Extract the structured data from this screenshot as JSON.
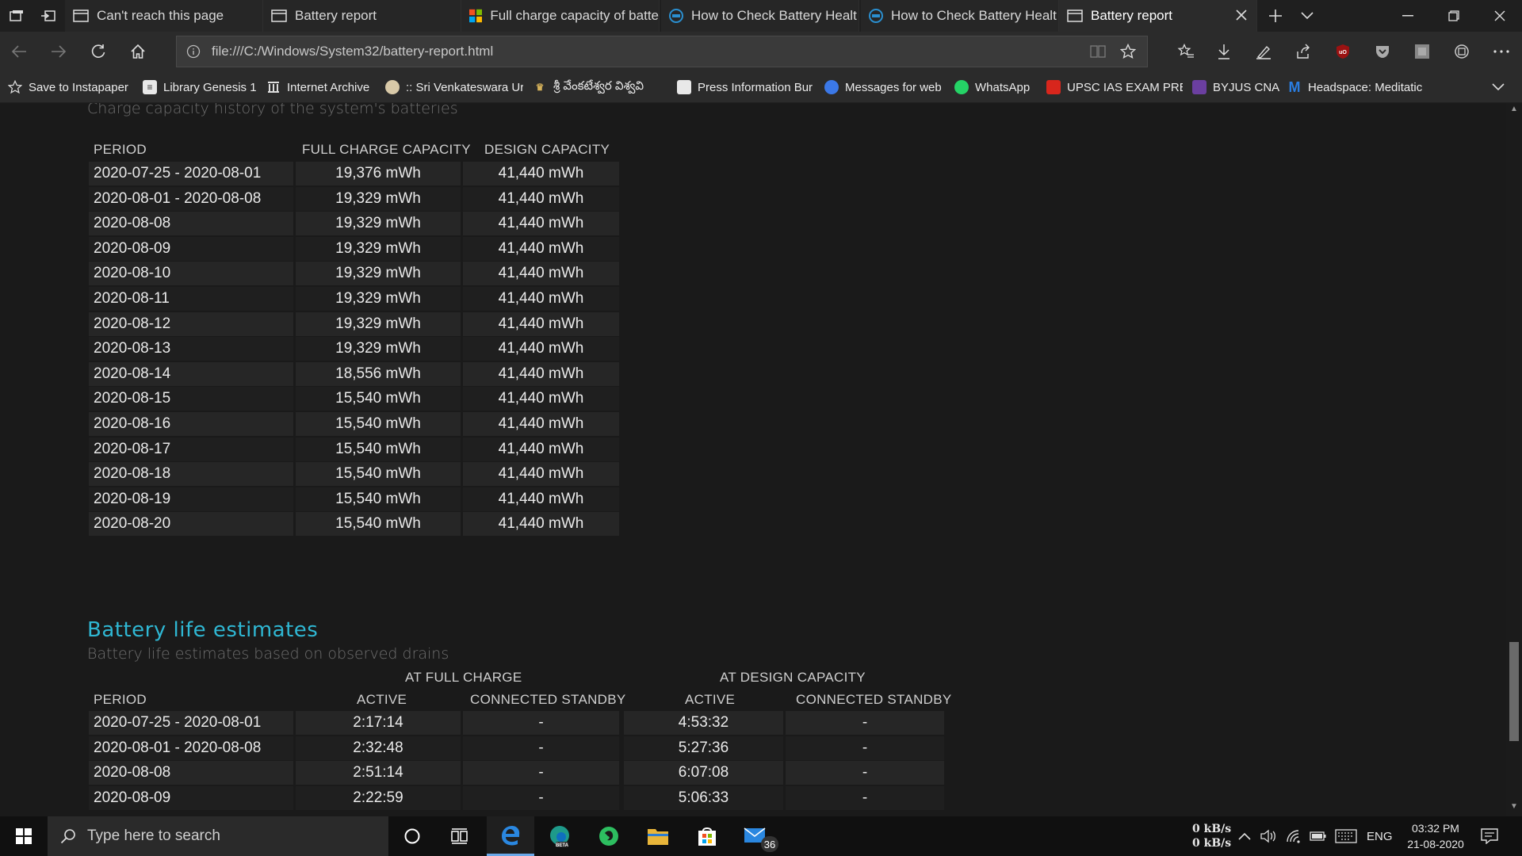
{
  "browser": {
    "tabs": [
      {
        "label": "Can't reach this page",
        "icon": "page-icon"
      },
      {
        "label": "Battery report",
        "icon": "page-icon"
      },
      {
        "label": "Full charge capacity of batte",
        "icon": "windows-logo-icon"
      },
      {
        "label": "How to Check Battery Healt",
        "icon": "site-favicon-icon"
      },
      {
        "label": "How to Check Battery Healt",
        "icon": "site-favicon-icon"
      },
      {
        "label": "Battery report",
        "icon": "page-icon",
        "active": true
      }
    ],
    "address": "file:///C:/Windows/System32/battery-report.html",
    "favorites": [
      {
        "label": "Save to Instapaper"
      },
      {
        "label": "Library Genesis 1"
      },
      {
        "label": "Internet Archive"
      },
      {
        "label": ":: Sri Venkateswara Ur"
      },
      {
        "label": "శ్రీ వేంకటేశ్వర విశ్వవి"
      },
      {
        "label": "Press Information Bur"
      },
      {
        "label": "Messages for web"
      },
      {
        "label": "WhatsApp"
      },
      {
        "label": "UPSC IAS EXAM PREF"
      },
      {
        "label": "BYJUS CNA"
      },
      {
        "label": "Headspace: Meditatic"
      }
    ]
  },
  "capacity_history": {
    "subtitle": "Charge capacity history of the system's batteries",
    "headers": [
      "PERIOD",
      "FULL CHARGE CAPACITY",
      "DESIGN CAPACITY"
    ],
    "rows": [
      [
        "2020-07-25 - 2020-08-01",
        "19,376 mWh",
        "41,440 mWh"
      ],
      [
        "2020-08-01 - 2020-08-08",
        "19,329 mWh",
        "41,440 mWh"
      ],
      [
        "2020-08-08",
        "19,329 mWh",
        "41,440 mWh"
      ],
      [
        "2020-08-09",
        "19,329 mWh",
        "41,440 mWh"
      ],
      [
        "2020-08-10",
        "19,329 mWh",
        "41,440 mWh"
      ],
      [
        "2020-08-11",
        "19,329 mWh",
        "41,440 mWh"
      ],
      [
        "2020-08-12",
        "19,329 mWh",
        "41,440 mWh"
      ],
      [
        "2020-08-13",
        "19,329 mWh",
        "41,440 mWh"
      ],
      [
        "2020-08-14",
        "18,556 mWh",
        "41,440 mWh"
      ],
      [
        "2020-08-15",
        "15,540 mWh",
        "41,440 mWh"
      ],
      [
        "2020-08-16",
        "15,540 mWh",
        "41,440 mWh"
      ],
      [
        "2020-08-17",
        "15,540 mWh",
        "41,440 mWh"
      ],
      [
        "2020-08-18",
        "15,540 mWh",
        "41,440 mWh"
      ],
      [
        "2020-08-19",
        "15,540 mWh",
        "41,440 mWh"
      ],
      [
        "2020-08-20",
        "15,540 mWh",
        "41,440 mWh"
      ]
    ]
  },
  "life_estimates": {
    "title": "Battery life estimates",
    "subtitle": "Battery life estimates based on observed drains",
    "group_headers": [
      "AT FULL CHARGE",
      "AT DESIGN CAPACITY"
    ],
    "headers": [
      "PERIOD",
      "ACTIVE",
      "CONNECTED STANDBY",
      "ACTIVE",
      "CONNECTED STANDBY"
    ],
    "rows": [
      [
        "2020-07-25 - 2020-08-01",
        "2:17:14",
        "-",
        "4:53:32",
        "-"
      ],
      [
        "2020-08-01 - 2020-08-08",
        "2:32:48",
        "-",
        "5:27:36",
        "-"
      ],
      [
        "2020-08-08",
        "2:51:14",
        "-",
        "6:07:08",
        "-"
      ],
      [
        "2020-08-09",
        "2:22:59",
        "-",
        "5:06:33",
        "-"
      ]
    ]
  },
  "taskbar": {
    "search_placeholder": "Type here to search",
    "mail_badge": "36",
    "net_up": "0 kB/s",
    "net_down": "0 kB/s",
    "language": "ENG",
    "time": "03:32 PM",
    "date": "21-08-2020"
  },
  "colors": {
    "heading": "#2fb7d3",
    "background": "#1a1a1a",
    "row_odd": "#262626",
    "row_even": "#1f1f1f"
  }
}
